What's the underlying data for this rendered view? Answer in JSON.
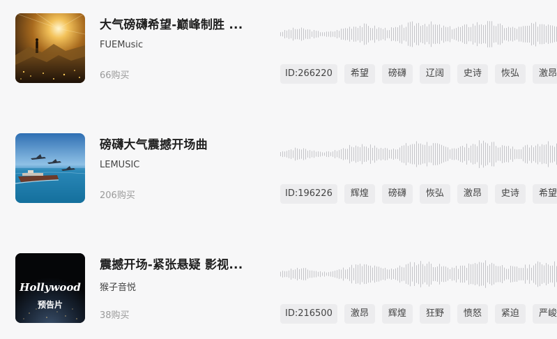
{
  "tracks": [
    {
      "title": "大气磅礴希望-巅峰制胜 ...",
      "artist": "FUEMusic",
      "buys": "66购买",
      "id_tag": "ID:266220",
      "tags": [
        "希望",
        "磅礴",
        "辽阔",
        "史诗",
        "恢弘",
        "激昂"
      ],
      "cover": "mountain-sunrise-hiker"
    },
    {
      "title": "磅礴大气震撼开场曲",
      "artist": "LEMUSIC",
      "buys": "206购买",
      "id_tag": "ID:196226",
      "tags": [
        "辉煌",
        "磅礴",
        "恢弘",
        "激昂",
        "史诗",
        "希望"
      ],
      "cover": "jets-over-ocean-ship"
    },
    {
      "title": "震撼开场-紧张悬疑 影视...",
      "artist": "猴子音悦",
      "buys": "38购买",
      "id_tag": "ID:216500",
      "tags": [
        "激昂",
        "辉煌",
        "狂野",
        "愤怒",
        "紧迫",
        "严峻"
      ],
      "cover": "hollywood-trailer",
      "cover_text": {
        "line1": "Hollywood",
        "line2": "预告片"
      }
    }
  ]
}
